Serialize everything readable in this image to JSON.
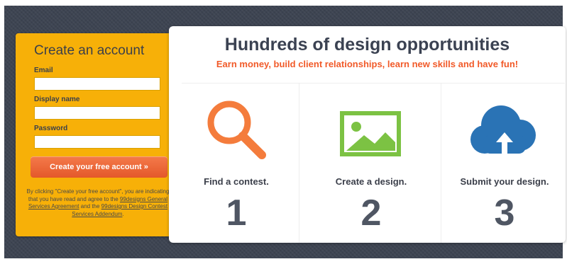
{
  "signup": {
    "title": "Create an account",
    "fields": [
      {
        "label": "Email",
        "value": "",
        "placeholder": ""
      },
      {
        "label": "Display name",
        "value": "",
        "placeholder": ""
      },
      {
        "label": "Password",
        "value": "",
        "placeholder": ""
      }
    ],
    "cta_label": "Create your free account »",
    "legal_text_1": "By clicking \"Create your free account\", you are indicating that you have read and agree to the ",
    "legal_link_1": "99designs General Services Agreement",
    "legal_text_2": " and the ",
    "legal_link_2": "99designs Design Contest Services Addendum",
    "legal_text_3": "."
  },
  "hero": {
    "headline": "Hundreds of design opportunities",
    "subheadline": "Earn money, build client relationships, learn new skills and have fun!"
  },
  "steps": [
    {
      "icon": "magnifier-icon",
      "label": "Find a contest.",
      "number": "1"
    },
    {
      "icon": "image-icon",
      "label": "Create a design.",
      "number": "2"
    },
    {
      "icon": "cloud-upload-icon",
      "label": "Submit your design.",
      "number": "3"
    }
  ],
  "colors": {
    "frame_bg": "#3d4452",
    "signup_bg": "#f7b008",
    "cta_bg": "#e4582a",
    "accent_orange": "#f15a29",
    "magnifier": "#f47c3c",
    "image_green": "#7cc243",
    "cloud_blue": "#2a73b5"
  }
}
